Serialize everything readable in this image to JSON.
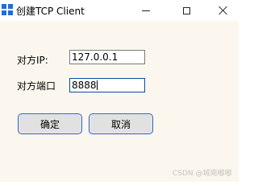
{
  "window": {
    "title": "创建TCP Client",
    "accent_color": "#1f6fd1",
    "controls": {
      "minimize": "minimize-icon",
      "maximize": "maximize-icon",
      "close": "close-icon"
    }
  },
  "form": {
    "ip_label": "对方IP:",
    "ip_value": "127.0.0.1",
    "port_label": "对方端口",
    "port_value": "8888"
  },
  "buttons": {
    "ok_label": "确定",
    "cancel_label": "取消"
  },
  "watermark": "CSDN @城南嘟嘟"
}
